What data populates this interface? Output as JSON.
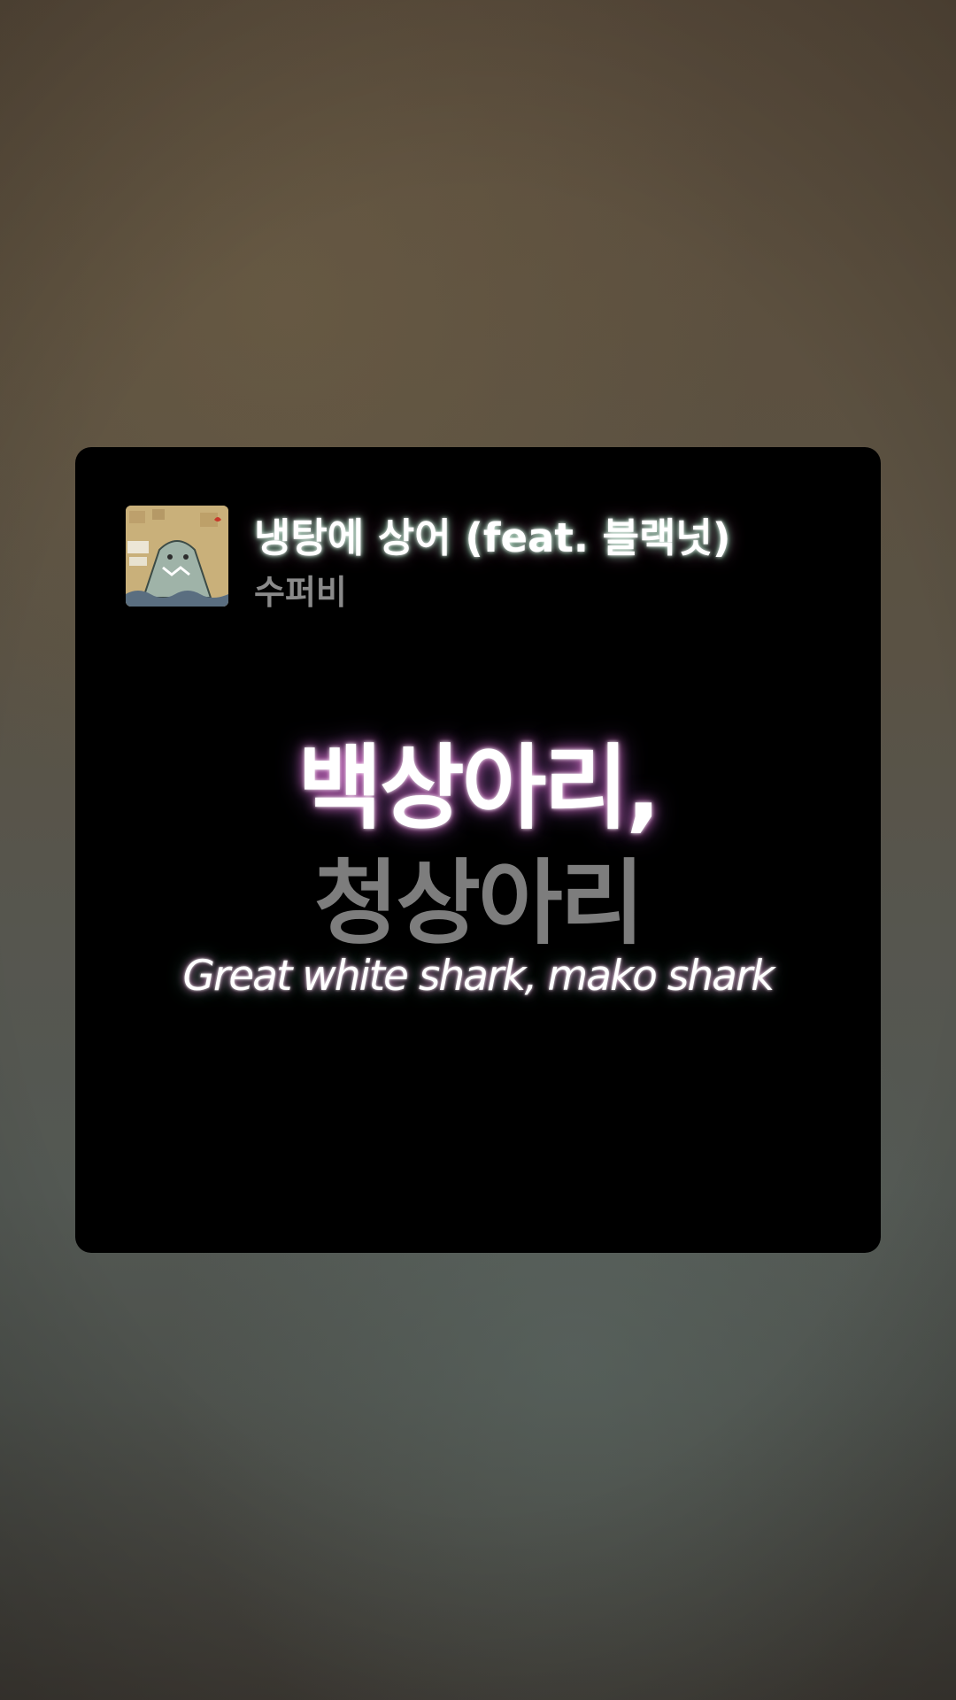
{
  "track": {
    "title": "냉탕에 상어 (feat. 블랙넛)",
    "artist": "수퍼비",
    "cover_icon": "album-cover-shark"
  },
  "lyrics": {
    "current_line": "백상아리,",
    "next_line": "청상아리",
    "translation": "Great white shark, mako shark"
  },
  "colors": {
    "card_background": "#000000",
    "active_text": "#ffffff",
    "inactive_text": "#7d7d7d",
    "artist_text": "#8a8a8a",
    "glow_pink": "#ff82e6",
    "glow_green": "#78ffb4"
  }
}
